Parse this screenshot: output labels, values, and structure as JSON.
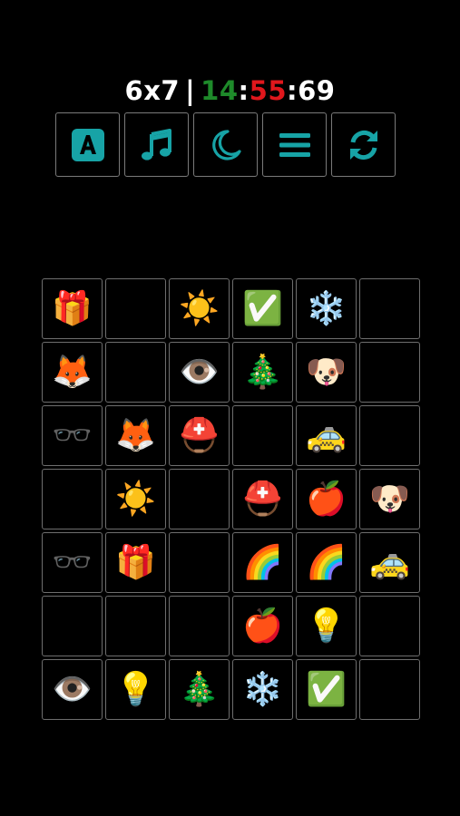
{
  "header": {
    "board_size": "6x7",
    "separator": "|",
    "time_a": "14",
    "colon_1": ":",
    "time_b": "55",
    "colon_2": ":",
    "time_c": "69"
  },
  "toolbar": {
    "buttons": [
      {
        "icon": "font-a-icon"
      },
      {
        "icon": "music-note-icon"
      },
      {
        "icon": "moon-icon"
      },
      {
        "icon": "menu-icon"
      },
      {
        "icon": "refresh-icon"
      }
    ],
    "accent_color": "#17a3a6"
  },
  "board": {
    "columns": 6,
    "rows": 7,
    "cells": [
      [
        "🎁",
        "",
        "☀️",
        "✅",
        "❄️",
        ""
      ],
      [
        "🦊",
        "",
        "👁️",
        "🎄",
        "🐶",
        ""
      ],
      [
        "🕶️",
        "🦊",
        "⛑️",
        "",
        "🚕",
        ""
      ],
      [
        "",
        "☀️",
        "",
        "⛑️",
        "🍎",
        "🐶"
      ],
      [
        "🕶️",
        "🎁",
        "",
        "🌈",
        "🌈",
        "🚕"
      ],
      [
        "",
        "",
        "",
        "🍎",
        "💡",
        ""
      ],
      [
        "👁️",
        "💡",
        "🎄",
        "❄️",
        "✅",
        ""
      ]
    ]
  }
}
